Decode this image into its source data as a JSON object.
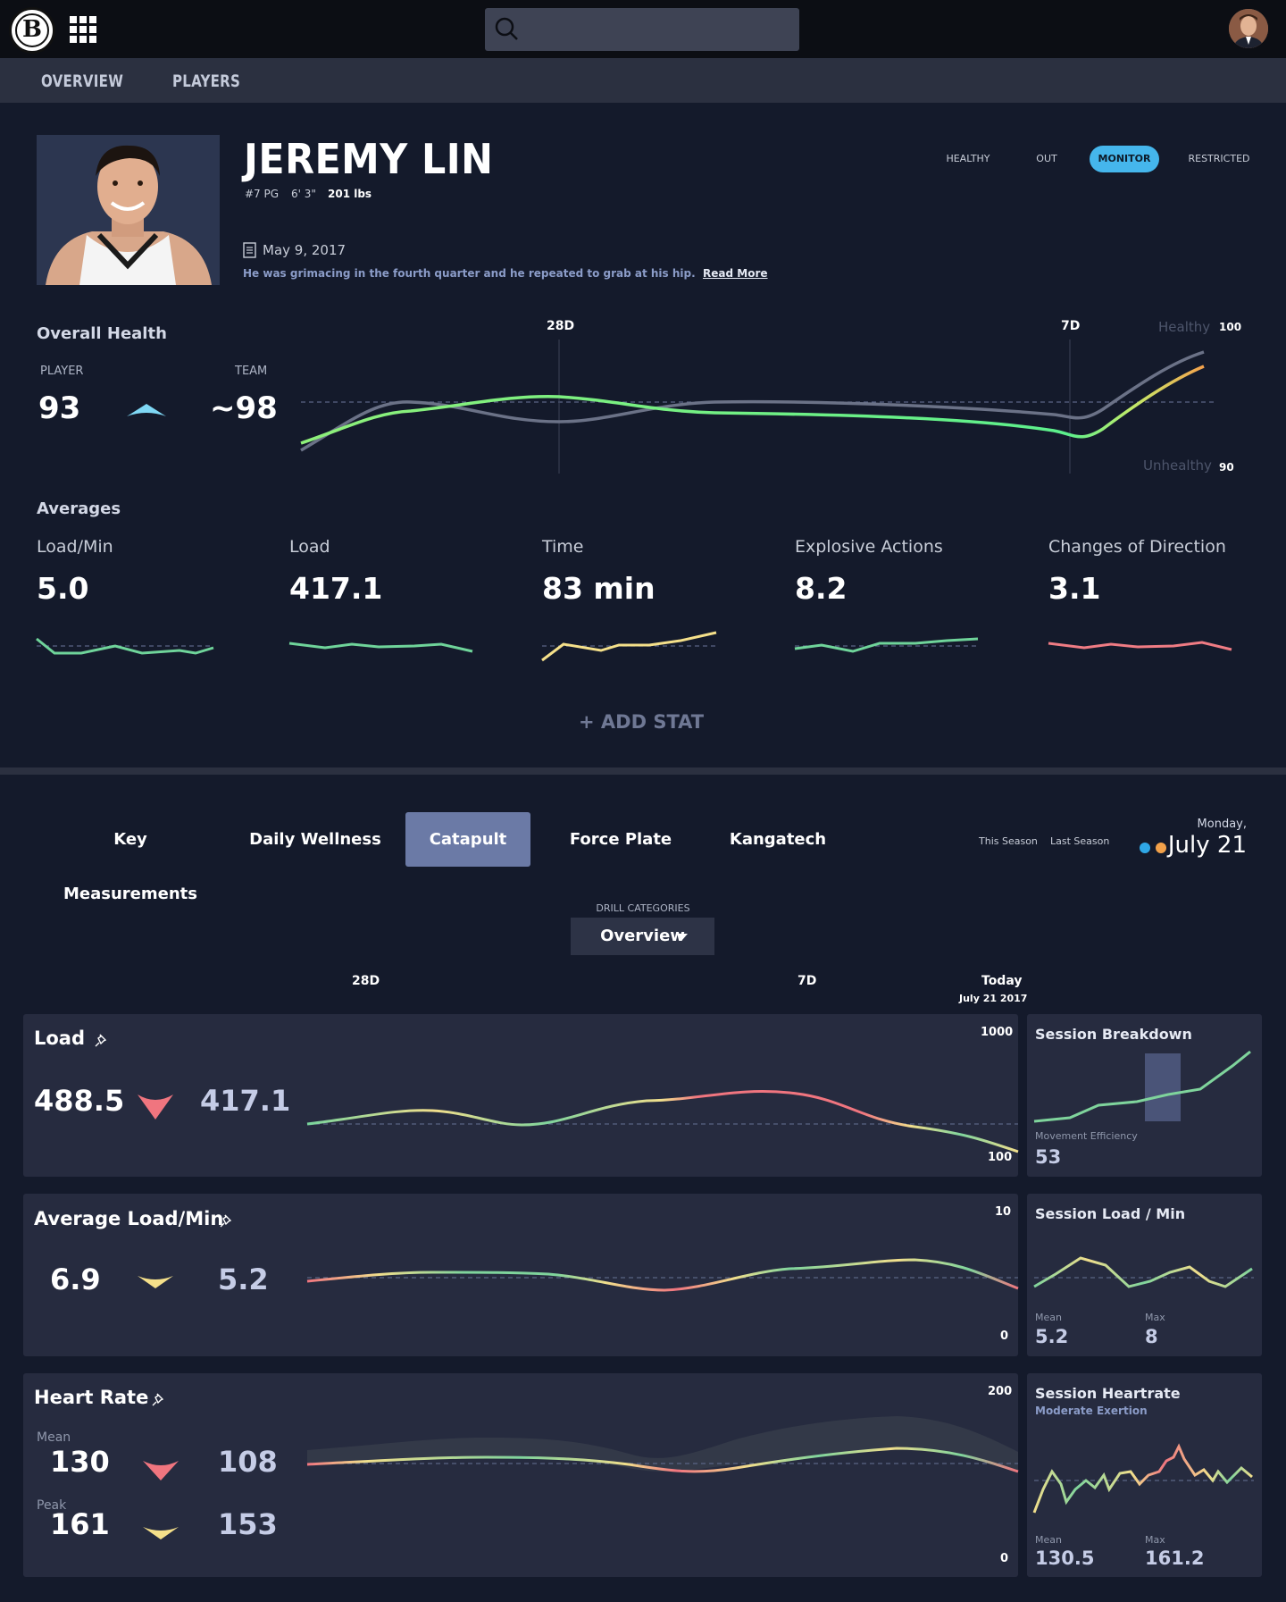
{
  "topbar": {
    "search_placeholder": ""
  },
  "nav": {
    "tabs": [
      "OVERVIEW",
      "PLAYERS"
    ]
  },
  "player": {
    "name": "JEREMY LIN",
    "number": "#7 PG",
    "height": "6' 3\"",
    "weight": "201 lbs",
    "statuses": [
      "HEALTHY",
      "OUT",
      "MONITOR",
      "RESTRICTED"
    ],
    "active_status": "MONITOR",
    "note_date": "May 9, 2017",
    "note_text": "He was grimacing in the fourth quarter and he repeated to grab at his hip.",
    "note_link": "Read More"
  },
  "overall_health": {
    "title": "Overall Health",
    "player_label": "PLAYER",
    "player_value": "93",
    "team_label": "TEAM",
    "team_value": "~98",
    "marker_28d": "28D",
    "marker_7d": "7D",
    "healthy_label": "Healthy",
    "healthy_value": "100",
    "unhealthy_label": "Unhealthy",
    "unhealthy_value": "90"
  },
  "averages": {
    "title": "Averages",
    "items": [
      {
        "label": "Load/Min",
        "value": "5.0",
        "color": "#6fd49a"
      },
      {
        "label": "Load",
        "value": "417.1",
        "color": "#6fd49a"
      },
      {
        "label": "Time",
        "value": "83 min",
        "color": "#f5e08a"
      },
      {
        "label": "Explosive Actions",
        "value": "8.2",
        "color": "#6fd49a"
      },
      {
        "label": "Changes of Direction",
        "value": "3.1",
        "color": "#f07c84"
      }
    ],
    "add_stat": "+ ADD STAT"
  },
  "detail_tabs": {
    "tabs": [
      "Key Measurements",
      "Daily Wellness",
      "Catapult",
      "Force Plate",
      "Kangatech"
    ],
    "active": "Catapult",
    "this_season": "This Season",
    "last_season": "Last Season",
    "this_season_color": "#2fa7e6",
    "last_season_color": "#f2a14a",
    "date_day": "Monday,",
    "date_main": "July 21"
  },
  "drill": {
    "label": "DRILL CATEGORIES",
    "value": "Overview"
  },
  "timeline": {
    "d28": "28D",
    "d7": "7D",
    "today": "Today",
    "today_date": "July 21 2017"
  },
  "cards": {
    "load": {
      "title": "Load",
      "from": "488.5",
      "to": "417.1",
      "max": "1000",
      "min": "100"
    },
    "avg_load_min": {
      "title": "Average Load/Min",
      "from": "6.9",
      "to": "5.2",
      "max": "10",
      "min": "0"
    },
    "heart_rate": {
      "title": "Heart Rate",
      "mean_label": "Mean",
      "mean_from": "130",
      "mean_to": "108",
      "peak_label": "Peak",
      "peak_from": "161",
      "peak_to": "153",
      "max": "200",
      "min": "0"
    }
  },
  "side": {
    "session_breakdown": {
      "title": "Session Breakdown",
      "label": "Movement Efficiency",
      "value": "53"
    },
    "session_load_min": {
      "title": "Session Load / Min",
      "mean_label": "Mean",
      "mean": "5.2",
      "max_label": "Max",
      "max": "8"
    },
    "session_heartrate": {
      "title": "Session Heartrate",
      "subtitle": "Moderate Exertion",
      "mean_label": "Mean",
      "mean": "130.5",
      "max_label": "Max",
      "max": "161.2"
    }
  }
}
